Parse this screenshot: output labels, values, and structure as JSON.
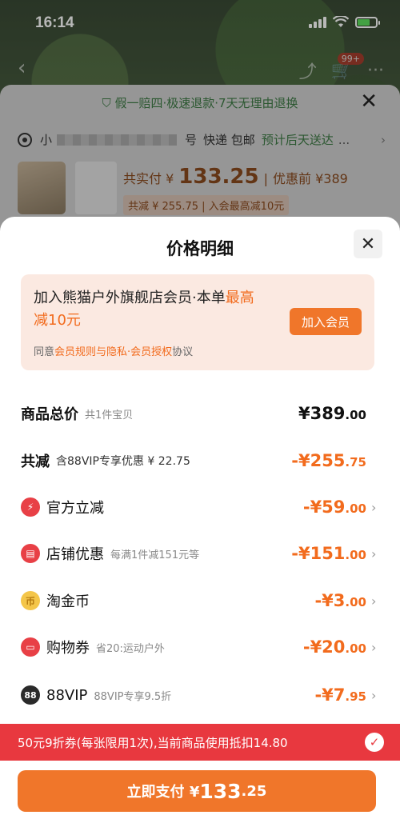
{
  "status_bar": {
    "time": "16:14"
  },
  "nav": {
    "cart_badge": "99+"
  },
  "underlay": {
    "guarantee": "假一赔四·极速退款·7天无理由退换",
    "address_prefix": "小",
    "address_suffix": "号",
    "shipping": "快递 包邮",
    "delivery": "预计后天送达",
    "paid_label": "共实付 ¥",
    "paid_amount": "133.25",
    "before_discount": "优惠前 ¥389",
    "reduce_line": "共减 ¥ 255.75 | 入会最高减10元"
  },
  "sheet": {
    "title": "价格明细",
    "promo": {
      "text_prefix": "加入熊猫户外旗舰店会员·本单",
      "text_highlight": "最高减10元",
      "agree_prefix": "同意",
      "agree_link": "会员规则与隐私·会员授权",
      "agree_suffix": "协议",
      "join_label": "加入会员"
    },
    "rows": [
      {
        "label": "商品总价",
        "note": "共1件宝贝",
        "amt_main": "¥389",
        "amt_cents": ".00"
      },
      {
        "label": "共减",
        "note": "含88VIP专享优惠 ¥ 22.75",
        "amt_main": "-¥255",
        "amt_cents": ".75"
      },
      {
        "label": "官方立减",
        "note": "",
        "amt_main": "-¥59",
        "amt_cents": ".00"
      },
      {
        "label": "店铺优惠",
        "note": "每满1件减151元等",
        "amt_main": "-¥151",
        "amt_cents": ".00"
      },
      {
        "label": "淘金币",
        "note": "",
        "amt_main": "-¥3",
        "amt_cents": ".00"
      },
      {
        "label": "购物券",
        "note": "省20:运动户外",
        "amt_main": "-¥20",
        "amt_cents": ".00"
      },
      {
        "label": "88VIP",
        "note": "88VIP专享9.5折",
        "amt_main": "-¥7",
        "amt_cents": ".95"
      }
    ],
    "coupon_bar": "50元9折券(每张限用1次),当前商品使用抵扣14.80",
    "pay_button": {
      "label": "立即支付 ¥",
      "amount": "133",
      "cents": ".25"
    }
  },
  "icons": {
    "official": "lightning-icon",
    "store": "store-icon",
    "coin": "coin-icon",
    "coupon": "ticket-icon",
    "vip": "vip-88-icon"
  }
}
